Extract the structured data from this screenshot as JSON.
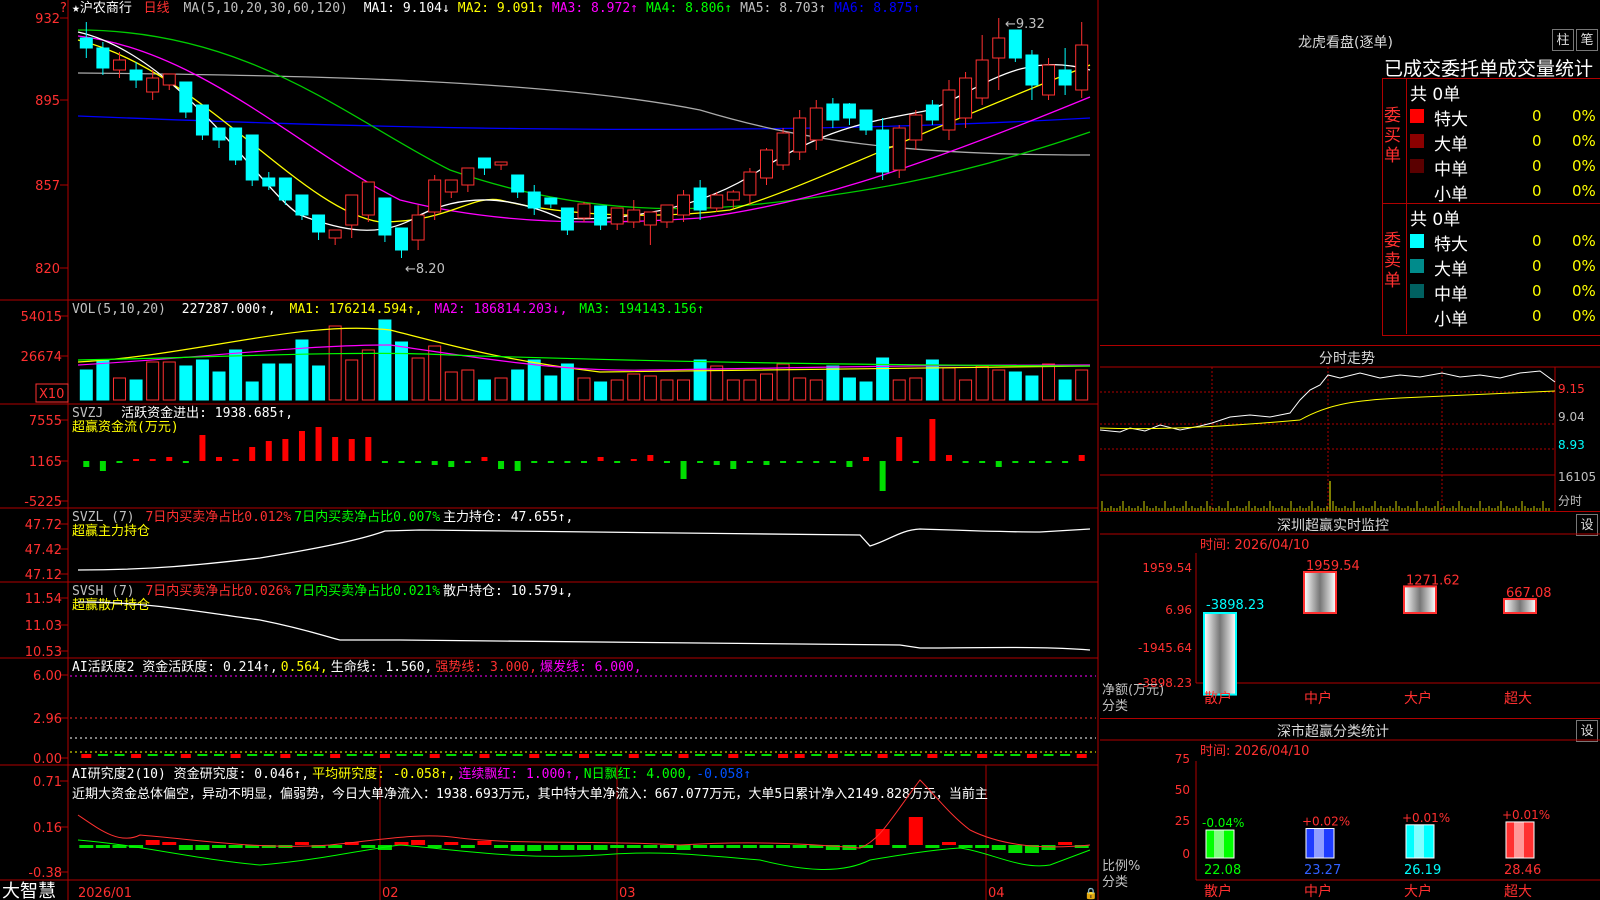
{
  "stock": {
    "name": "★沪农商行",
    "period": "日线",
    "ma_label": "MA(5,10,20,30,60,120)",
    "ma_values": [
      {
        "t": "MA1: 9.104↓",
        "c": "#ffffff"
      },
      {
        "t": "MA2: 9.091↑",
        "c": "#ffff00"
      },
      {
        "t": "MA3: 8.972↑",
        "c": "#ff00ff"
      },
      {
        "t": "MA4: 8.806↑",
        "c": "#00ff00"
      },
      {
        "t": "MA5: 8.703↑",
        "c": "#c0c0c0"
      },
      {
        "t": "MA6: 8.875↑",
        "c": "#0000ff"
      }
    ]
  },
  "price_axis": [
    "932",
    "895",
    "857",
    "820"
  ],
  "price_annotations": {
    "high": "9.32",
    "low": "8.20"
  },
  "vol": {
    "label": "VOL(5,10,20)",
    "value": "227287.000↑,",
    "ma1": "MA1: 176214.594↑,",
    "ma2": "MA2: 186814.203↓,",
    "ma3": "MA3: 194143.156↑",
    "axis": [
      "54015",
      "26674"
    ],
    "unit": "X10"
  },
  "svzj": {
    "label": "SVZJ",
    "title": "活跃资金进出: 1938.685↑,",
    "subtitle": "超赢资金流(万元)",
    "axis": [
      "7555",
      "1165",
      "-5225"
    ]
  },
  "svzl": {
    "line1": [
      {
        "t": "SVZL (7) ",
        "c": "#c0c0c0"
      },
      {
        "t": "7日内买卖净占比0.012%",
        "c": "#ff3030"
      },
      {
        "t": "7日内买卖净占比0.007%",
        "c": "#00ff00"
      },
      {
        "t": "主力持仓: 47.655↑,",
        "c": "#ffffff"
      }
    ],
    "subtitle": "超赢主力持仓",
    "axis": [
      "47.72",
      "47.42",
      "47.12"
    ]
  },
  "svsh": {
    "line1": [
      {
        "t": "SVSH (7) ",
        "c": "#c0c0c0"
      },
      {
        "t": "7日内买卖净占比0.026%",
        "c": "#ff3030"
      },
      {
        "t": "7日内买卖净占比0.021%",
        "c": "#00ff00"
      },
      {
        "t": "散户持仓: 10.579↓,",
        "c": "#ffffff"
      }
    ],
    "subtitle": "超赢散户持仓",
    "axis": [
      "11.54",
      "11.03",
      "10.53"
    ]
  },
  "ai_active": {
    "line1": [
      {
        "t": "AI活跃度2 资金活跃度: 0.214↑,",
        "c": "#ffffff"
      },
      {
        "t": "0.564,",
        "c": "#ffff00"
      },
      {
        "t": "生命线: 1.560,",
        "c": "#ffffff"
      },
      {
        "t": "强势线: 3.000,",
        "c": "#ff3030"
      },
      {
        "t": "爆发线: 6.000,",
        "c": "#ff00ff"
      }
    ],
    "axis": [
      "6.00",
      "2.96",
      "0.00"
    ]
  },
  "ai_research": {
    "line1": [
      {
        "t": "AI研究度2(10) 资金研究度: 0.046↑,",
        "c": "#ffffff"
      },
      {
        "t": "平均研究度: -0.058↑,",
        "c": "#ffff00"
      },
      {
        "t": "连续飘红: 1.000↑,",
        "c": "#ff00ff"
      },
      {
        "t": "N日飘红: 4.000,",
        "c": "#00ff00"
      },
      {
        "t": "-0.058↑",
        "c": "#0050ff"
      }
    ],
    "text": "近期大资金总体偏空，异动不明显，偏弱势，今日大单净流入：1938.693万元，其中特大单净流入：667.077万元，大单5日累计净入2149.828万元，当前主",
    "axis": [
      "0.71",
      "0.16",
      "-0.38"
    ]
  },
  "date_axis": [
    "2026/01",
    "02",
    "03",
    "04"
  ],
  "footer": {
    "brand": "大智慧"
  },
  "dragon": {
    "title": "龙虎看盘(逐单)",
    "btn1": "柱",
    "btn2": "笔",
    "subtitle": "已成交委托单成交量统计",
    "buy": {
      "label": "委买单",
      "total": "共 0单",
      "rows": [
        {
          "name": "特大",
          "v": "0",
          "p": "0%",
          "c": "#ff0000"
        },
        {
          "name": "大单",
          "v": "0",
          "p": "0%",
          "c": "#8b0000"
        },
        {
          "name": "中单",
          "v": "0",
          "p": "0%",
          "c": "#5a0000"
        },
        {
          "name": "小单",
          "v": "0",
          "p": "0%",
          "c": ""
        }
      ]
    },
    "sell": {
      "label": "委卖单",
      "total": "共 0单",
      "rows": [
        {
          "name": "特大",
          "v": "0",
          "p": "0%",
          "c": "#00ffff"
        },
        {
          "name": "大单",
          "v": "0",
          "p": "0%",
          "c": "#008b8b"
        },
        {
          "name": "中单",
          "v": "0",
          "p": "0%",
          "c": "#006060"
        },
        {
          "name": "小单",
          "v": "0",
          "p": "0%",
          "c": ""
        }
      ]
    }
  },
  "intraday": {
    "title": "分时走势",
    "axis": [
      "9.15",
      "9.04",
      "8.93",
      "16105"
    ],
    "unit": "分时"
  },
  "monitor": {
    "title": "深圳超赢实时监控",
    "btn": "设",
    "time": "时间: 2026/04/10",
    "axis": [
      "1959.54",
      "6.96",
      "-1945.64",
      "-3898.23"
    ],
    "ylabel": "净额(万元)",
    "xlabel": "分类",
    "bars": [
      {
        "cat": "散户",
        "value": -3898.23,
        "label": "-3898.23"
      },
      {
        "cat": "中户",
        "value": 1959.54,
        "label": "1959.54"
      },
      {
        "cat": "大户",
        "value": 1271.62,
        "label": "1271.62"
      },
      {
        "cat": "超大",
        "value": 667.08,
        "label": "667.08"
      }
    ]
  },
  "classify": {
    "title": "深市超赢分类统计",
    "btn": "设",
    "time": "时间: 2026/04/10",
    "axis": [
      "75",
      "50",
      "25",
      "0"
    ],
    "ylabel": "比例%",
    "xlabel": "分类",
    "bars": [
      {
        "cat": "散户",
        "value": 22.08,
        "label": "22.08",
        "change": "-0.04%",
        "color": "#00ff00"
      },
      {
        "cat": "中户",
        "value": 23.27,
        "label": "23.27",
        "change": "+0.02%",
        "color": "#1e3cff"
      },
      {
        "cat": "大户",
        "value": 26.19,
        "label": "26.19",
        "change": "+0.01%",
        "color": "#00ffff"
      },
      {
        "cat": "超大",
        "value": 28.46,
        "label": "28.46",
        "change": "+0.01%",
        "color": "#ff3030"
      }
    ]
  },
  "chart_data": [
    {
      "type": "bar",
      "title": "深圳超赢实时监控",
      "categories": [
        "散户",
        "中户",
        "大户",
        "超大"
      ],
      "values": [
        -3898.23,
        1959.54,
        1271.62,
        667.08
      ],
      "ylabel": "净额(万元)",
      "xlabel": "分类"
    },
    {
      "type": "bar",
      "title": "深市超赢分类统计",
      "categories": [
        "散户",
        "中户",
        "大户",
        "超大"
      ],
      "values": [
        22.08,
        23.27,
        26.19,
        28.46
      ],
      "ylabel": "比例%",
      "xlabel": "分类",
      "ylim": [
        0,
        75
      ]
    }
  ]
}
